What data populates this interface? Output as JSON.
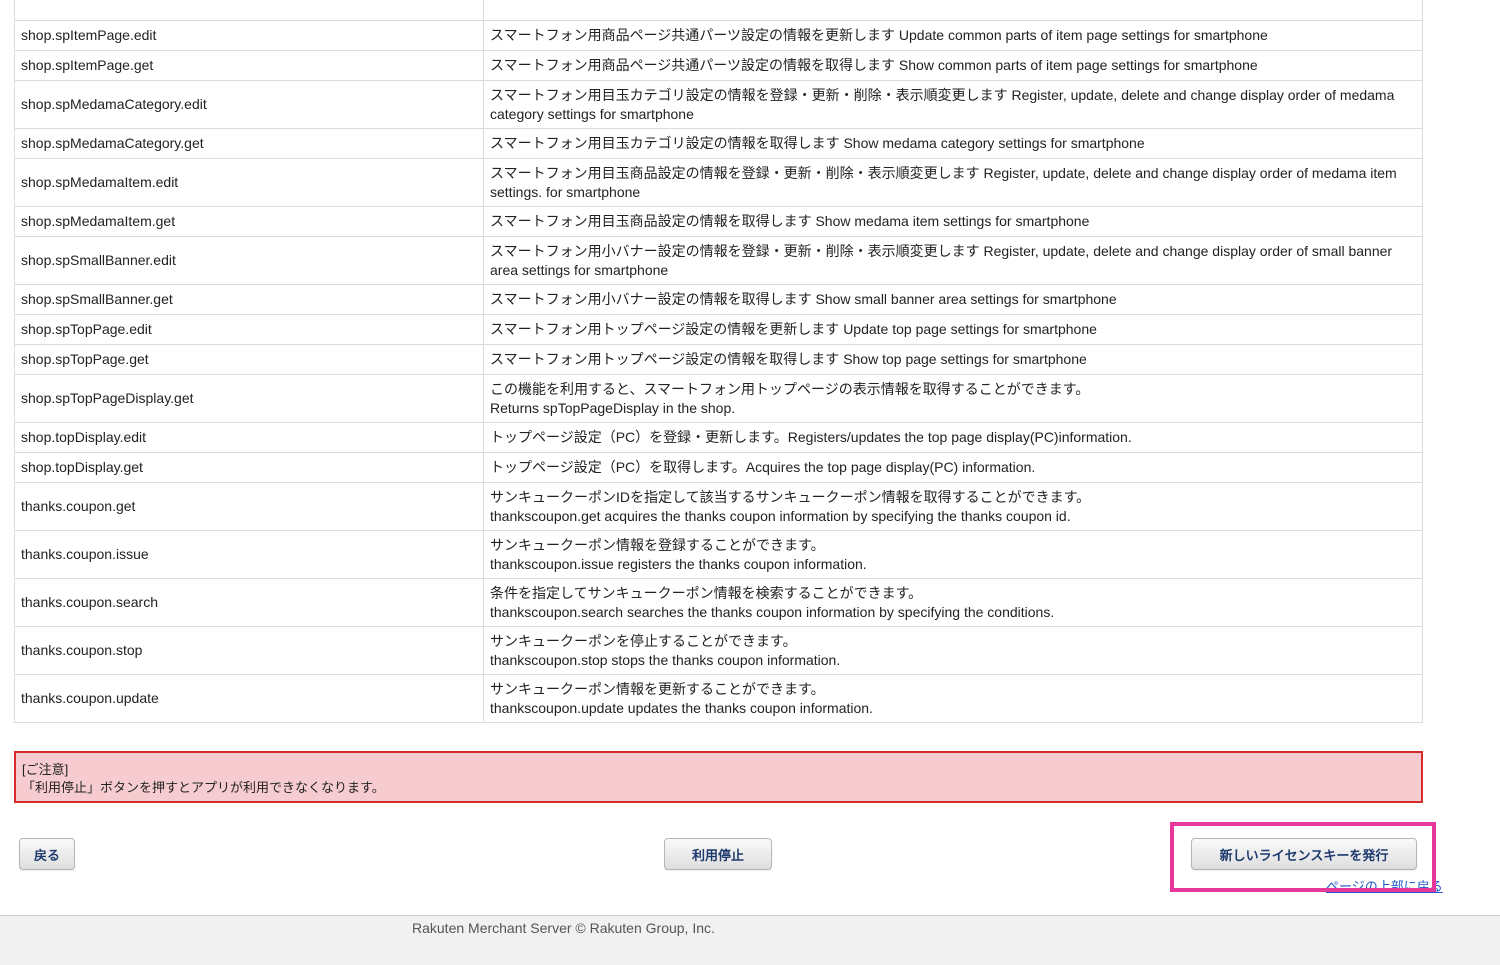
{
  "api_rows": [
    {
      "name": "shop.spItemPage.edit",
      "desc": [
        "スマートフォン用商品ページ共通パーツ設定の情報を更新します Update common parts of item page settings for smartphone"
      ]
    },
    {
      "name": "shop.spItemPage.get",
      "desc": [
        "スマートフォン用商品ページ共通パーツ設定の情報を取得します Show common parts of item page settings for smartphone"
      ]
    },
    {
      "name": "shop.spMedamaCategory.edit",
      "desc": [
        "スマートフォン用目玉カテゴリ設定の情報を登録・更新・削除・表示順変更します Register, update, delete and change display order of medama",
        "category settings for smartphone"
      ]
    },
    {
      "name": "shop.spMedamaCategory.get",
      "desc": [
        "スマートフォン用目玉カテゴリ設定の情報を取得します Show medama category settings for smartphone"
      ]
    },
    {
      "name": "shop.spMedamaItem.edit",
      "desc": [
        "スマートフォン用目玉商品設定の情報を登録・更新・削除・表示順変更します Register, update, delete and change display order of medama item",
        "settings. for smartphone"
      ]
    },
    {
      "name": "shop.spMedamaItem.get",
      "desc": [
        "スマートフォン用目玉商品設定の情報を取得します Show medama item settings for smartphone"
      ]
    },
    {
      "name": "shop.spSmallBanner.edit",
      "desc": [
        "スマートフォン用小バナー設定の情報を登録・更新・削除・表示順変更します Register, update, delete and change display order of small banner",
        "area settings for smartphone"
      ]
    },
    {
      "name": "shop.spSmallBanner.get",
      "desc": [
        "スマートフォン用小バナー設定の情報を取得します Show small banner area settings for smartphone"
      ]
    },
    {
      "name": "shop.spTopPage.edit",
      "desc": [
        "スマートフォン用トップページ設定の情報を更新します Update top page settings for smartphone"
      ]
    },
    {
      "name": "shop.spTopPage.get",
      "desc": [
        "スマートフォン用トップページ設定の情報を取得します Show top page settings for smartphone"
      ]
    },
    {
      "name": "shop.spTopPageDisplay.get",
      "desc": [
        "この機能を利用すると、スマートフォン用トップページの表示情報を取得することができます。",
        "Returns spTopPageDisplay in the shop."
      ]
    },
    {
      "name": "shop.topDisplay.edit",
      "desc": [
        "トップページ設定（PC）を登録・更新します。Registers/updates the top page display(PC)information."
      ]
    },
    {
      "name": "shop.topDisplay.get",
      "desc": [
        "トップページ設定（PC）を取得します。Acquires the top page display(PC) information."
      ]
    },
    {
      "name": "thanks.coupon.get",
      "desc": [
        "サンキュークーポンIDを指定して該当するサンキュークーポン情報を取得することができます。",
        "thankscoupon.get acquires the thanks coupon information by specifying the thanks coupon id."
      ]
    },
    {
      "name": "thanks.coupon.issue",
      "desc": [
        "サンキュークーポン情報を登録することができます。",
        "thankscoupon.issue registers the thanks coupon information."
      ]
    },
    {
      "name": "thanks.coupon.search",
      "desc": [
        "条件を指定してサンキュークーポン情報を検索することができます。",
        "thankscoupon.search searches the thanks coupon information by specifying the conditions."
      ]
    },
    {
      "name": "thanks.coupon.stop",
      "desc": [
        "サンキュークーポンを停止することができます。",
        "thankscoupon.stop stops the thanks coupon information."
      ]
    },
    {
      "name": "thanks.coupon.update",
      "desc": [
        "サンキュークーポン情報を更新することができます。",
        "thankscoupon.update updates the thanks coupon information."
      ]
    }
  ],
  "notice": {
    "title": "[ご注意]",
    "message": "「利用停止」ボタンを押すとアプリが利用できなくなります。"
  },
  "buttons": {
    "back": "戻る",
    "stop": "利用停止",
    "issue_key": "新しいライセンスキーを発行"
  },
  "links": {
    "back_to_top": "ページの上部に戻る"
  },
  "footer": {
    "copyright": "Rakuten Merchant Server © Rakuten Group, Inc."
  },
  "colors": {
    "notice_bg": "#f7ccd0",
    "notice_border": "#d42b2b",
    "highlight": "#e8379a",
    "link": "#1a56c9"
  }
}
